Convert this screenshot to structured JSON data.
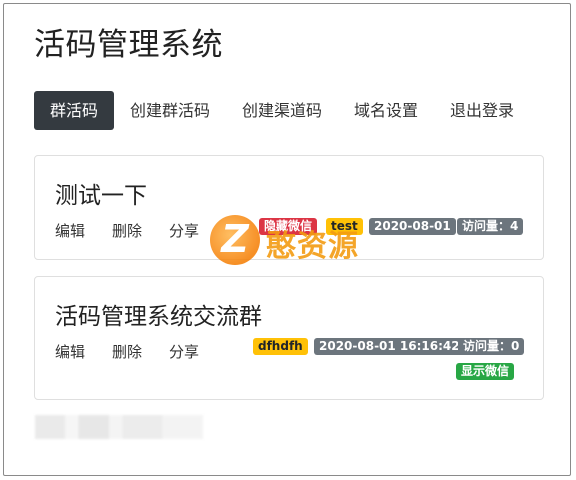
{
  "app": {
    "title": "活码管理系统"
  },
  "nav": [
    {
      "label": "群活码",
      "active": true
    },
    {
      "label": "创建群活码",
      "active": false
    },
    {
      "label": "创建渠道码",
      "active": false
    },
    {
      "label": "域名设置",
      "active": false
    },
    {
      "label": "退出登录",
      "active": false
    }
  ],
  "cards": [
    {
      "title": "测试一下",
      "actions": {
        "edit": "编辑",
        "delete": "删除",
        "share": "分享"
      },
      "badges": {
        "hidden_wechat": "隐藏微信",
        "tag": "test",
        "date": "2020-08-01",
        "visits": "访问量：4"
      }
    },
    {
      "title": "活码管理系统交流群",
      "actions": {
        "edit": "编辑",
        "delete": "删除",
        "share": "分享"
      },
      "badges": {
        "tag": "dfhdfh",
        "date": "2020-08-01 16:16:42",
        "visits": "访问量：0",
        "show_wechat": "显示微信"
      }
    }
  ],
  "watermark": {
    "logo_letter": "Z",
    "text": "憨资源"
  },
  "colors": {
    "nav_active_bg": "#343a40",
    "danger": "#dc3545",
    "warning": "#ffc107",
    "secondary": "#6c757d",
    "success": "#28a745"
  }
}
